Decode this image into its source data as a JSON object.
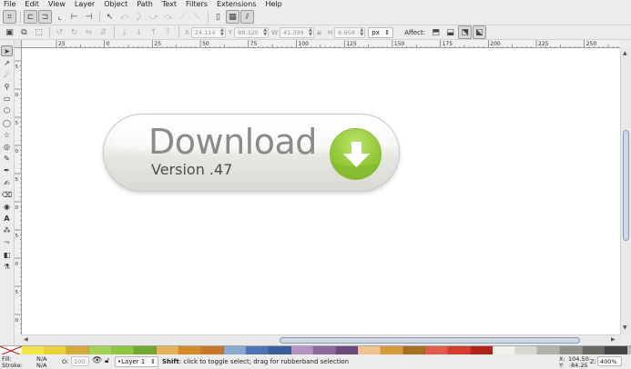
{
  "menu": [
    "File",
    "Edit",
    "View",
    "Layer",
    "Object",
    "Path",
    "Text",
    "Filters",
    "Extensions",
    "Help"
  ],
  "icons": {
    "command_bar": [
      "select-all-icon",
      "select-same-icon",
      "rotate-ccw-icon",
      "rotate-cw-icon",
      "flip-h-icon",
      "flip-v-icon",
      "raise-icon",
      "lower-icon",
      "raise-top-icon",
      "lower-bottom-icon"
    ],
    "tools": [
      "selector-tool-icon",
      "node-tool-icon",
      "tweak-tool-icon",
      "zoom-tool-icon",
      "rect-tool-icon",
      "box3d-tool-icon",
      "ellipse-tool-icon",
      "star-tool-icon",
      "spiral-tool-icon",
      "pencil-tool-icon",
      "pen-tool-icon",
      "calligraphy-tool-icon",
      "eraser-tool-icon",
      "paint-bucket-icon",
      "text-tool-icon",
      "spray-tool-icon",
      "connector-tool-icon",
      "gradient-tool-icon",
      "dropper-tool-icon"
    ]
  },
  "controls": {
    "x_label": "X",
    "x_value": "24.114",
    "y_label": "Y",
    "y_value": "88.320",
    "w_label": "W",
    "w_value": "41.399",
    "h_label": "H",
    "h_value": "6.958",
    "unit": "px",
    "affect_label": "Affect:"
  },
  "ruler": {
    "h_labels": [
      "25",
      "0",
      "25",
      "50",
      "75",
      "100",
      "125",
      "150",
      "175",
      "200",
      "225",
      "250"
    ],
    "v_labels": [
      "5",
      "0",
      "5",
      "0",
      "5",
      "0",
      "5",
      "0",
      "5",
      "0"
    ]
  },
  "artwork": {
    "title": "Download",
    "subtitle": "Version .47",
    "colors": {
      "circle": "#93c83a",
      "arrow": "#ffffff"
    }
  },
  "palette": [
    "#f3e44a",
    "#e9d23a",
    "#d6ab3e",
    "#a5d05a",
    "#8ec63f",
    "#73a832",
    "#e8b25c",
    "#d58a2a",
    "#c7762a",
    "#8aa8d0",
    "#4e72b3",
    "#3a5e9c",
    "#b494c2",
    "#8c6a9f",
    "#6c4a7c",
    "#eec38e",
    "#d69a3d",
    "#a66f23",
    "#e25b4c",
    "#d53c2f",
    "#b1241a",
    "#f1f1ee",
    "#d6d6d2",
    "#b3b3ae",
    "#8f8f8b",
    "#6a6a67",
    "#454543"
  ],
  "status": {
    "fill_label": "Fill:",
    "fill_value": "N/A",
    "stroke_label": "Stroke:",
    "stroke_value": "N/A",
    "opacity_label": "O:",
    "opacity_value": "100",
    "layer": "•Layer 1",
    "message_bold": "Shift",
    "message": ": click to toggle select; drag for rubberband selection",
    "x_label": "X:",
    "x_value": "104.50",
    "y_label": "Y:",
    "y_value": "84.25",
    "zoom_label": "Z:",
    "zoom_value": "400%"
  }
}
